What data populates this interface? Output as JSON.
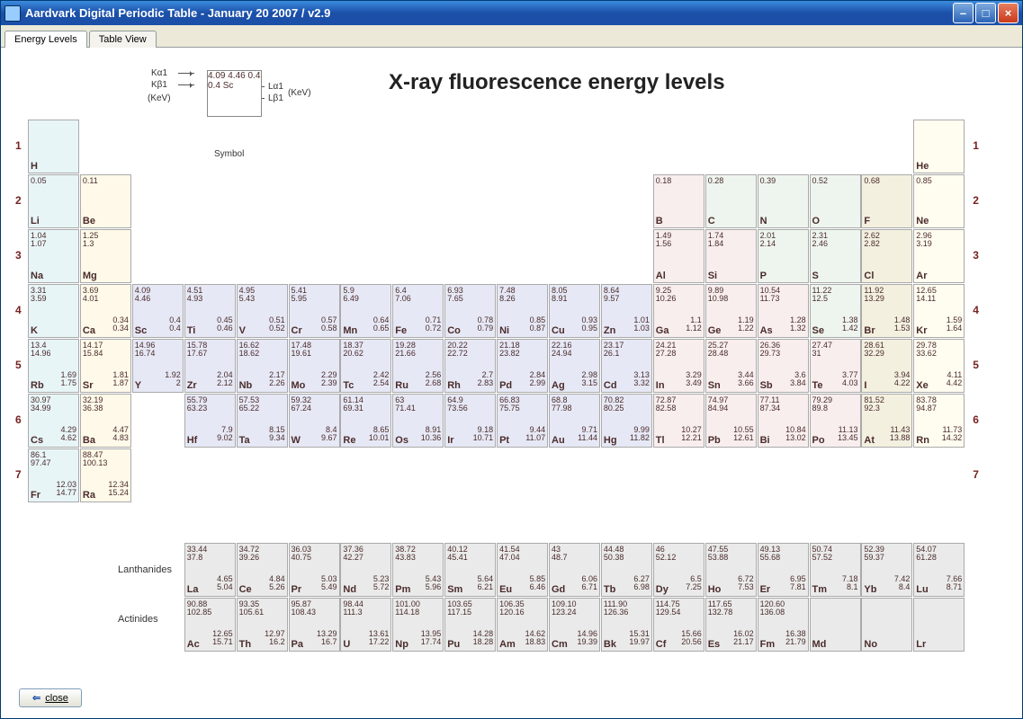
{
  "window": {
    "title": "Aardvark Digital Periodic Table - January 20 2007 / v2.9"
  },
  "tabs": {
    "active": "Energy Levels",
    "other": "Table View"
  },
  "heading": "X-ray fluorescence energy levels",
  "legend": {
    "Ka": "Kα1",
    "Kb": "Kβ1",
    "kev1": "(KeV)",
    "La": "Lα1",
    "Lb": "Lβ1",
    "kev2": "(KeV)",
    "symbol": "Symbol",
    "cell": {
      "ka": "4.09",
      "kb": "4.46",
      "la": "0.4",
      "lb": "0.4",
      "sym": "Sc"
    }
  },
  "rowlabels": [
    "1",
    "2",
    "3",
    "4",
    "5",
    "6",
    "7"
  ],
  "series": {
    "lanth": "Lanthanides",
    "act": "Actinides"
  },
  "closeLabel": "close",
  "cells": [
    {
      "r": 0,
      "c": 0,
      "sym": "H",
      "cls": "alk"
    },
    {
      "r": 0,
      "c": 17,
      "sym": "He",
      "cls": "nob"
    },
    {
      "r": 1,
      "c": 0,
      "sym": "Li",
      "cls": "alk",
      "ka": "0.05"
    },
    {
      "r": 1,
      "c": 1,
      "sym": "Be",
      "cls": "aem",
      "ka": "0.11"
    },
    {
      "r": 1,
      "c": 12,
      "sym": "B",
      "cls": "pt1",
      "ka": "0.18"
    },
    {
      "r": 1,
      "c": 13,
      "sym": "C",
      "cls": "pt2",
      "ka": "0.28"
    },
    {
      "r": 1,
      "c": 14,
      "sym": "N",
      "cls": "pt2",
      "ka": "0.39"
    },
    {
      "r": 1,
      "c": 15,
      "sym": "O",
      "cls": "pt2",
      "ka": "0.52"
    },
    {
      "r": 1,
      "c": 16,
      "sym": "F",
      "cls": "hal",
      "ka": "0.68"
    },
    {
      "r": 1,
      "c": 17,
      "sym": "Ne",
      "cls": "nob",
      "ka": "0.85"
    },
    {
      "r": 2,
      "c": 0,
      "sym": "Na",
      "cls": "alk",
      "ka": "1.04",
      "kb": "1.07"
    },
    {
      "r": 2,
      "c": 1,
      "sym": "Mg",
      "cls": "aem",
      "ka": "1.25",
      "kb": "1.3"
    },
    {
      "r": 2,
      "c": 12,
      "sym": "Al",
      "cls": "pt1",
      "ka": "1.49",
      "kb": "1.56"
    },
    {
      "r": 2,
      "c": 13,
      "sym": "Si",
      "cls": "pt1",
      "ka": "1.74",
      "kb": "1.84"
    },
    {
      "r": 2,
      "c": 14,
      "sym": "P",
      "cls": "pt2",
      "ka": "2.01",
      "kb": "2.14"
    },
    {
      "r": 2,
      "c": 15,
      "sym": "S",
      "cls": "pt2",
      "ka": "2.31",
      "kb": "2.46"
    },
    {
      "r": 2,
      "c": 16,
      "sym": "Cl",
      "cls": "hal",
      "ka": "2.62",
      "kb": "2.82"
    },
    {
      "r": 2,
      "c": 17,
      "sym": "Ar",
      "cls": "nob",
      "ka": "2.96",
      "kb": "3.19"
    },
    {
      "r": 3,
      "c": 0,
      "sym": "K",
      "cls": "alk",
      "ka": "3.31",
      "kb": "3.59"
    },
    {
      "r": 3,
      "c": 1,
      "sym": "Ca",
      "cls": "aem",
      "ka": "3.69",
      "kb": "4.01",
      "la": "0.34",
      "lb": "0.34"
    },
    {
      "r": 3,
      "c": 2,
      "sym": "Sc",
      "cls": "tm",
      "ka": "4.09",
      "kb": "4.46",
      "la": "0.4",
      "lb": "0.4"
    },
    {
      "r": 3,
      "c": 3,
      "sym": "Ti",
      "cls": "tm",
      "ka": "4.51",
      "kb": "4.93",
      "la": "0.45",
      "lb": "0.46"
    },
    {
      "r": 3,
      "c": 4,
      "sym": "V",
      "cls": "tm",
      "ka": "4.95",
      "kb": "5.43",
      "la": "0.51",
      "lb": "0.52"
    },
    {
      "r": 3,
      "c": 5,
      "sym": "Cr",
      "cls": "tm",
      "ka": "5.41",
      "kb": "5.95",
      "la": "0.57",
      "lb": "0.58"
    },
    {
      "r": 3,
      "c": 6,
      "sym": "Mn",
      "cls": "tm",
      "ka": "5.9",
      "kb": "6.49",
      "la": "0.64",
      "lb": "0.65"
    },
    {
      "r": 3,
      "c": 7,
      "sym": "Fe",
      "cls": "tm",
      "ka": "6.4",
      "kb": "7.06",
      "la": "0.71",
      "lb": "0.72"
    },
    {
      "r": 3,
      "c": 8,
      "sym": "Co",
      "cls": "tm",
      "ka": "6.93",
      "kb": "7.65",
      "la": "0.78",
      "lb": "0.79"
    },
    {
      "r": 3,
      "c": 9,
      "sym": "Ni",
      "cls": "tm",
      "ka": "7.48",
      "kb": "8.26",
      "la": "0.85",
      "lb": "0.87"
    },
    {
      "r": 3,
      "c": 10,
      "sym": "Cu",
      "cls": "tm",
      "ka": "8.05",
      "kb": "8.91",
      "la": "0.93",
      "lb": "0.95"
    },
    {
      "r": 3,
      "c": 11,
      "sym": "Zn",
      "cls": "tm",
      "ka": "8.64",
      "kb": "9.57",
      "la": "1.01",
      "lb": "1.03"
    },
    {
      "r": 3,
      "c": 12,
      "sym": "Ga",
      "cls": "pt1",
      "ka": "9.25",
      "kb": "10.26",
      "la": "1.1",
      "lb": "1.12"
    },
    {
      "r": 3,
      "c": 13,
      "sym": "Ge",
      "cls": "pt1",
      "ka": "9.89",
      "kb": "10.98",
      "la": "1.19",
      "lb": "1.22"
    },
    {
      "r": 3,
      "c": 14,
      "sym": "As",
      "cls": "pt1",
      "ka": "10.54",
      "kb": "11.73",
      "la": "1.28",
      "lb": "1.32"
    },
    {
      "r": 3,
      "c": 15,
      "sym": "Se",
      "cls": "pt2",
      "ka": "11.22",
      "kb": "12.5",
      "la": "1.38",
      "lb": "1.42"
    },
    {
      "r": 3,
      "c": 16,
      "sym": "Br",
      "cls": "hal",
      "ka": "11.92",
      "kb": "13.29",
      "la": "1.48",
      "lb": "1.53"
    },
    {
      "r": 3,
      "c": 17,
      "sym": "Kr",
      "cls": "nob",
      "ka": "12.65",
      "kb": "14.11",
      "la": "1.59",
      "lb": "1.64"
    },
    {
      "r": 4,
      "c": 0,
      "sym": "Rb",
      "cls": "alk",
      "ka": "13.4",
      "kb": "14.96",
      "la": "1.69",
      "lb": "1.75"
    },
    {
      "r": 4,
      "c": 1,
      "sym": "Sr",
      "cls": "aem",
      "ka": "14.17",
      "kb": "15.84",
      "la": "1.81",
      "lb": "1.87"
    },
    {
      "r": 4,
      "c": 2,
      "sym": "Y",
      "cls": "tm",
      "ka": "14.96",
      "kb": "16.74",
      "la": "1.92",
      "lb": "2"
    },
    {
      "r": 4,
      "c": 3,
      "sym": "Zr",
      "cls": "tm",
      "ka": "15.78",
      "kb": "17.67",
      "la": "2.04",
      "lb": "2.12"
    },
    {
      "r": 4,
      "c": 4,
      "sym": "Nb",
      "cls": "tm",
      "ka": "16.62",
      "kb": "18.62",
      "la": "2.17",
      "lb": "2.26"
    },
    {
      "r": 4,
      "c": 5,
      "sym": "Mo",
      "cls": "tm",
      "ka": "17.48",
      "kb": "19.61",
      "la": "2.29",
      "lb": "2.39"
    },
    {
      "r": 4,
      "c": 6,
      "sym": "Tc",
      "cls": "tm",
      "ka": "18.37",
      "kb": "20.62",
      "la": "2.42",
      "lb": "2.54"
    },
    {
      "r": 4,
      "c": 7,
      "sym": "Ru",
      "cls": "tm",
      "ka": "19.28",
      "kb": "21.66",
      "la": "2.56",
      "lb": "2.68"
    },
    {
      "r": 4,
      "c": 8,
      "sym": "Rh",
      "cls": "tm",
      "ka": "20.22",
      "kb": "22.72",
      "la": "2.7",
      "lb": "2.83"
    },
    {
      "r": 4,
      "c": 9,
      "sym": "Pd",
      "cls": "tm",
      "ka": "21.18",
      "kb": "23.82",
      "la": "2.84",
      "lb": "2.99"
    },
    {
      "r": 4,
      "c": 10,
      "sym": "Ag",
      "cls": "tm",
      "ka": "22.16",
      "kb": "24.94",
      "la": "2.98",
      "lb": "3.15"
    },
    {
      "r": 4,
      "c": 11,
      "sym": "Cd",
      "cls": "tm",
      "ka": "23.17",
      "kb": "26.1",
      "la": "3.13",
      "lb": "3.32"
    },
    {
      "r": 4,
      "c": 12,
      "sym": "In",
      "cls": "pt1",
      "ka": "24.21",
      "kb": "27.28",
      "la": "3.29",
      "lb": "3.49"
    },
    {
      "r": 4,
      "c": 13,
      "sym": "Sn",
      "cls": "pt1",
      "ka": "25.27",
      "kb": "28.48",
      "la": "3.44",
      "lb": "3.66"
    },
    {
      "r": 4,
      "c": 14,
      "sym": "Sb",
      "cls": "pt1",
      "ka": "26.36",
      "kb": "29.73",
      "la": "3.6",
      "lb": "3.84"
    },
    {
      "r": 4,
      "c": 15,
      "sym": "Te",
      "cls": "pt1",
      "ka": "27.47",
      "kb": "31",
      "la": "3.77",
      "lb": "4.03"
    },
    {
      "r": 4,
      "c": 16,
      "sym": "I",
      "cls": "hal",
      "ka": "28.61",
      "kb": "32.29",
      "la": "3.94",
      "lb": "4.22"
    },
    {
      "r": 4,
      "c": 17,
      "sym": "Xe",
      "cls": "nob",
      "ka": "29.78",
      "kb": "33.62",
      "la": "4.11",
      "lb": "4.42"
    },
    {
      "r": 5,
      "c": 0,
      "sym": "Cs",
      "cls": "alk",
      "ka": "30.97",
      "kb": "34.99",
      "la": "4.29",
      "lb": "4.62"
    },
    {
      "r": 5,
      "c": 1,
      "sym": "Ba",
      "cls": "aem",
      "ka": "32.19",
      "kb": "36.38",
      "la": "4.47",
      "lb": "4.83"
    },
    {
      "r": 5,
      "c": 3,
      "sym": "Hf",
      "cls": "tm",
      "ka": "55.79",
      "kb": "63.23",
      "la": "7.9",
      "lb": "9.02"
    },
    {
      "r": 5,
      "c": 4,
      "sym": "Ta",
      "cls": "tm",
      "ka": "57.53",
      "kb": "65.22",
      "la": "8.15",
      "lb": "9.34"
    },
    {
      "r": 5,
      "c": 5,
      "sym": "W",
      "cls": "tm",
      "ka": "59.32",
      "kb": "67.24",
      "la": "8.4",
      "lb": "9.67"
    },
    {
      "r": 5,
      "c": 6,
      "sym": "Re",
      "cls": "tm",
      "ka": "61.14",
      "kb": "69.31",
      "la": "8.65",
      "lb": "10.01"
    },
    {
      "r": 5,
      "c": 7,
      "sym": "Os",
      "cls": "tm",
      "ka": "63",
      "kb": "71.41",
      "la": "8.91",
      "lb": "10.36"
    },
    {
      "r": 5,
      "c": 8,
      "sym": "Ir",
      "cls": "tm",
      "ka": "64.9",
      "kb": "73.56",
      "la": "9.18",
      "lb": "10.71"
    },
    {
      "r": 5,
      "c": 9,
      "sym": "Pt",
      "cls": "tm",
      "ka": "66.83",
      "kb": "75.75",
      "la": "9.44",
      "lb": "11.07"
    },
    {
      "r": 5,
      "c": 10,
      "sym": "Au",
      "cls": "tm",
      "ka": "68.8",
      "kb": "77.98",
      "la": "9.71",
      "lb": "11.44"
    },
    {
      "r": 5,
      "c": 11,
      "sym": "Hg",
      "cls": "tm",
      "ka": "70.82",
      "kb": "80.25",
      "la": "9.99",
      "lb": "11.82"
    },
    {
      "r": 5,
      "c": 12,
      "sym": "Tl",
      "cls": "pt1",
      "ka": "72.87",
      "kb": "82.58",
      "la": "10.27",
      "lb": "12.21"
    },
    {
      "r": 5,
      "c": 13,
      "sym": "Pb",
      "cls": "pt1",
      "ka": "74.97",
      "kb": "84.94",
      "la": "10.55",
      "lb": "12.61"
    },
    {
      "r": 5,
      "c": 14,
      "sym": "Bi",
      "cls": "pt1",
      "ka": "77.11",
      "kb": "87.34",
      "la": "10.84",
      "lb": "13.02"
    },
    {
      "r": 5,
      "c": 15,
      "sym": "Po",
      "cls": "pt1",
      "ka": "79.29",
      "kb": "89.8",
      "la": "11.13",
      "lb": "13.45"
    },
    {
      "r": 5,
      "c": 16,
      "sym": "At",
      "cls": "hal",
      "ka": "81.52",
      "kb": "92.3",
      "la": "11.43",
      "lb": "13.88"
    },
    {
      "r": 5,
      "c": 17,
      "sym": "Rn",
      "cls": "nob",
      "ka": "83.78",
      "kb": "94.87",
      "la": "11.73",
      "lb": "14.32"
    },
    {
      "r": 6,
      "c": 0,
      "sym": "Fr",
      "cls": "alk",
      "ka": "86.1",
      "kb": "97.47",
      "la": "12.03",
      "lb": "14.77"
    },
    {
      "r": 6,
      "c": 1,
      "sym": "Ra",
      "cls": "aem",
      "ka": "88.47",
      "kb": "100.13",
      "la": "12.34",
      "lb": "15.24"
    }
  ],
  "lanth": [
    {
      "sym": "La",
      "ka": "33.44",
      "kb": "37.8",
      "la": "4.65",
      "lb": "5.04"
    },
    {
      "sym": "Ce",
      "ka": "34.72",
      "kb": "39.26",
      "la": "4.84",
      "lb": "5.26"
    },
    {
      "sym": "Pr",
      "ka": "36.03",
      "kb": "40.75",
      "la": "5.03",
      "lb": "5.49"
    },
    {
      "sym": "Nd",
      "ka": "37.36",
      "kb": "42.27",
      "la": "5.23",
      "lb": "5.72"
    },
    {
      "sym": "Pm",
      "ka": "38.72",
      "kb": "43.83",
      "la": "5.43",
      "lb": "5.96"
    },
    {
      "sym": "Sm",
      "ka": "40.12",
      "kb": "45.41",
      "la": "5.64",
      "lb": "6.21"
    },
    {
      "sym": "Eu",
      "ka": "41.54",
      "kb": "47.04",
      "la": "5.85",
      "lb": "6.46"
    },
    {
      "sym": "Gd",
      "ka": "43",
      "kb": "48.7",
      "la": "6.06",
      "lb": "6.71"
    },
    {
      "sym": "Tb",
      "ka": "44.48",
      "kb": "50.38",
      "la": "6.27",
      "lb": "6.98"
    },
    {
      "sym": "Dy",
      "ka": "46",
      "kb": "52.12",
      "la": "6.5",
      "lb": "7.25"
    },
    {
      "sym": "Ho",
      "ka": "47.55",
      "kb": "53.88",
      "la": "6.72",
      "lb": "7.53"
    },
    {
      "sym": "Er",
      "ka": "49.13",
      "kb": "55.68",
      "la": "6.95",
      "lb": "7.81"
    },
    {
      "sym": "Tm",
      "ka": "50.74",
      "kb": "57.52",
      "la": "7.18",
      "lb": "8.1"
    },
    {
      "sym": "Yb",
      "ka": "52.39",
      "kb": "59.37",
      "la": "7.42",
      "lb": "8.4"
    },
    {
      "sym": "Lu",
      "ka": "54.07",
      "kb": "61.28",
      "la": "7.66",
      "lb": "8.71"
    }
  ],
  "act": [
    {
      "sym": "Ac",
      "ka": "90.88",
      "kb": "102.85",
      "la": "12.65",
      "lb": "15.71"
    },
    {
      "sym": "Th",
      "ka": "93.35",
      "kb": "105.61",
      "la": "12.97",
      "lb": "16.2"
    },
    {
      "sym": "Pa",
      "ka": "95.87",
      "kb": "108.43",
      "la": "13.29",
      "lb": "16.7"
    },
    {
      "sym": "U",
      "ka": "98.44",
      "kb": "111.3",
      "la": "13.61",
      "lb": "17.22"
    },
    {
      "sym": "Np",
      "ka": "101.00",
      "kb": "114.18",
      "la": "13.95",
      "lb": "17.74"
    },
    {
      "sym": "Pu",
      "ka": "103.65",
      "kb": "117.15",
      "la": "14.28",
      "lb": "18.28"
    },
    {
      "sym": "Am",
      "ka": "106.35",
      "kb": "120.16",
      "la": "14.62",
      "lb": "18.83"
    },
    {
      "sym": "Cm",
      "ka": "109.10",
      "kb": "123.24",
      "la": "14.96",
      "lb": "19.39"
    },
    {
      "sym": "Bk",
      "ka": "111.90",
      "kb": "126.36",
      "la": "15.31",
      "lb": "19.97"
    },
    {
      "sym": "Cf",
      "ka": "114.75",
      "kb": "129.54",
      "la": "15.66",
      "lb": "20.56"
    },
    {
      "sym": "Es",
      "ka": "117.65",
      "kb": "132.78",
      "la": "16.02",
      "lb": "21.17"
    },
    {
      "sym": "Fm",
      "ka": "120.60",
      "kb": "136.08",
      "la": "16.38",
      "lb": "21.79"
    },
    {
      "sym": "Md"
    },
    {
      "sym": "No"
    },
    {
      "sym": "Lr"
    }
  ]
}
